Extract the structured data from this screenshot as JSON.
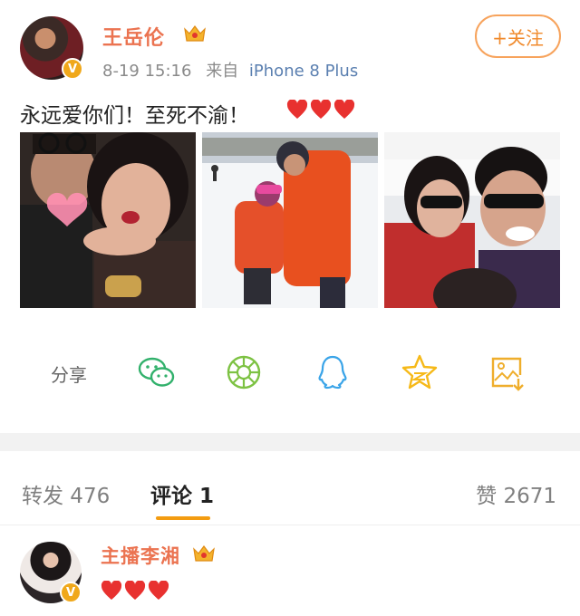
{
  "post": {
    "username": "王岳伦",
    "meta_time": "8-19 15:16",
    "meta_from": "来自",
    "meta_source": "iPhone 8 Plus",
    "follow_label": "+关注",
    "text": "永远爱你们！至死不渝！",
    "heart_count": 3,
    "verified_badge": "V",
    "photos": [
      "photo-1",
      "photo-2",
      "photo-3"
    ]
  },
  "share": {
    "label": "分享",
    "icons": [
      "wechat-icon",
      "moments-icon",
      "qq-icon",
      "qzone-star-icon",
      "save-image-icon"
    ]
  },
  "tabs": {
    "repost_label": "转发 476",
    "comment_label": "评论 1",
    "like_label": "赞 2671"
  },
  "comment": {
    "username": "主播李湘",
    "verified_badge": "V",
    "heart_count": 3
  },
  "colors": {
    "username": "#eb7350",
    "follow_border": "#f7a35c",
    "badge": "#f0a81b",
    "heart": "#e8312f",
    "tab_indicator": "#f39c11",
    "source_link": "#5a7fb0"
  }
}
